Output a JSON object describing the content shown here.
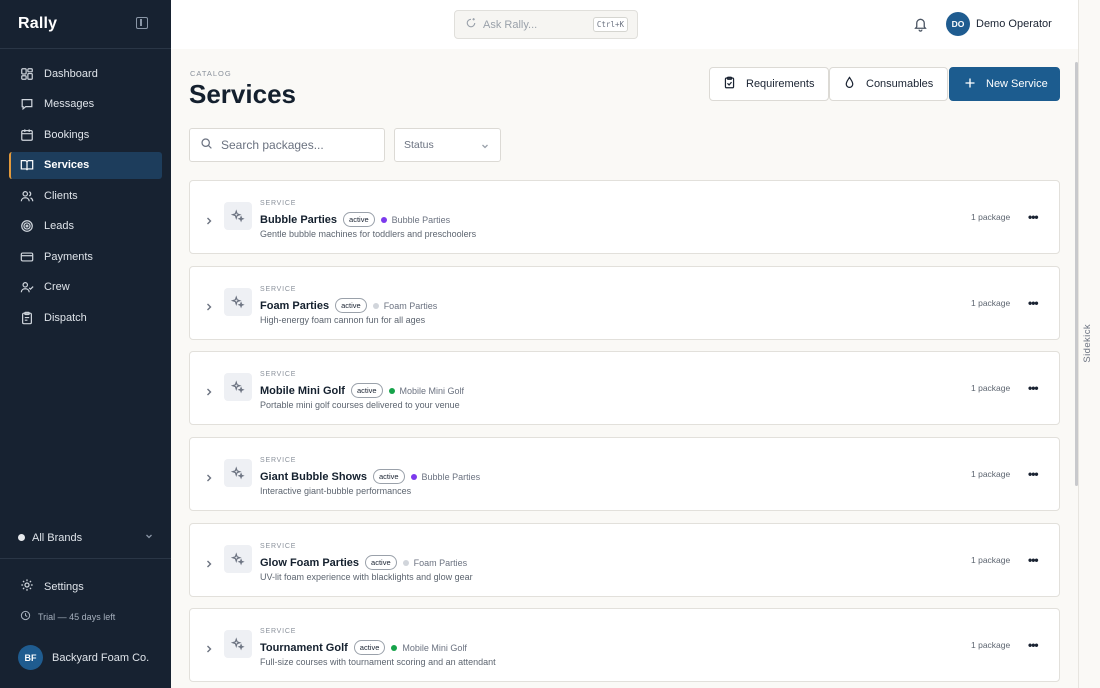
{
  "app": {
    "brand": "Rally"
  },
  "sidebar": {
    "items": [
      {
        "label": "Dashboard",
        "icon": "dashboard-icon",
        "active": false
      },
      {
        "label": "Messages",
        "icon": "message-icon",
        "active": false
      },
      {
        "label": "Bookings",
        "icon": "calendar-icon",
        "active": false
      },
      {
        "label": "Services",
        "icon": "book-icon",
        "active": true
      },
      {
        "label": "Clients",
        "icon": "users-icon",
        "active": false
      },
      {
        "label": "Leads",
        "icon": "target-icon",
        "active": false
      },
      {
        "label": "Payments",
        "icon": "card-icon",
        "active": false
      },
      {
        "label": "Crew",
        "icon": "user-check-icon",
        "active": false
      },
      {
        "label": "Dispatch",
        "icon": "clipboard-icon",
        "active": false
      }
    ],
    "brands_filter": "All Brands",
    "settings_label": "Settings",
    "trial_text": "Trial — 45 days left",
    "org": {
      "initials": "BF",
      "name": "Backyard Foam Co."
    }
  },
  "topbar": {
    "ask_placeholder": "Ask Rally...",
    "shortcut": "Ctrl+K",
    "user": {
      "initials": "DO",
      "name": "Demo Operator"
    }
  },
  "rail": {
    "label": "Sidekick"
  },
  "header": {
    "eyebrow": "CATALOG",
    "title": "Services",
    "requirements_label": "Requirements",
    "consumables_label": "Consumables",
    "new_service_label": "New Service"
  },
  "filters": {
    "search_placeholder": "Search packages...",
    "status_label": "Status"
  },
  "colors": {
    "purple_brand": "#7c3aed",
    "gray_brand": "#d1d5db",
    "green_brand": "#16a34a",
    "accent": "#1c5c8f"
  },
  "services": [
    {
      "eyebrow": "SERVICE",
      "name": "Bubble Parties",
      "status": "active",
      "brand": "Bubble Parties",
      "brand_color": "#7c3aed",
      "description": "Gentle bubble machines for toddlers and preschoolers",
      "packages": "1 package"
    },
    {
      "eyebrow": "SERVICE",
      "name": "Foam Parties",
      "status": "active",
      "brand": "Foam Parties",
      "brand_color": "#d1d5db",
      "description": "High-energy foam cannon fun for all ages",
      "packages": "1 package"
    },
    {
      "eyebrow": "SERVICE",
      "name": "Mobile Mini Golf",
      "status": "active",
      "brand": "Mobile Mini Golf",
      "brand_color": "#16a34a",
      "description": "Portable mini golf courses delivered to your venue",
      "packages": "1 package"
    },
    {
      "eyebrow": "SERVICE",
      "name": "Giant Bubble Shows",
      "status": "active",
      "brand": "Bubble Parties",
      "brand_color": "#7c3aed",
      "description": "Interactive giant-bubble performances",
      "packages": "1 package"
    },
    {
      "eyebrow": "SERVICE",
      "name": "Glow Foam Parties",
      "status": "active",
      "brand": "Foam Parties",
      "brand_color": "#d1d5db",
      "description": "UV-lit foam experience with blacklights and glow gear",
      "packages": "1 package"
    },
    {
      "eyebrow": "SERVICE",
      "name": "Tournament Golf",
      "status": "active",
      "brand": "Mobile Mini Golf",
      "brand_color": "#16a34a",
      "description": "Full-size courses with tournament scoring and an attendant",
      "packages": "1 package"
    }
  ]
}
